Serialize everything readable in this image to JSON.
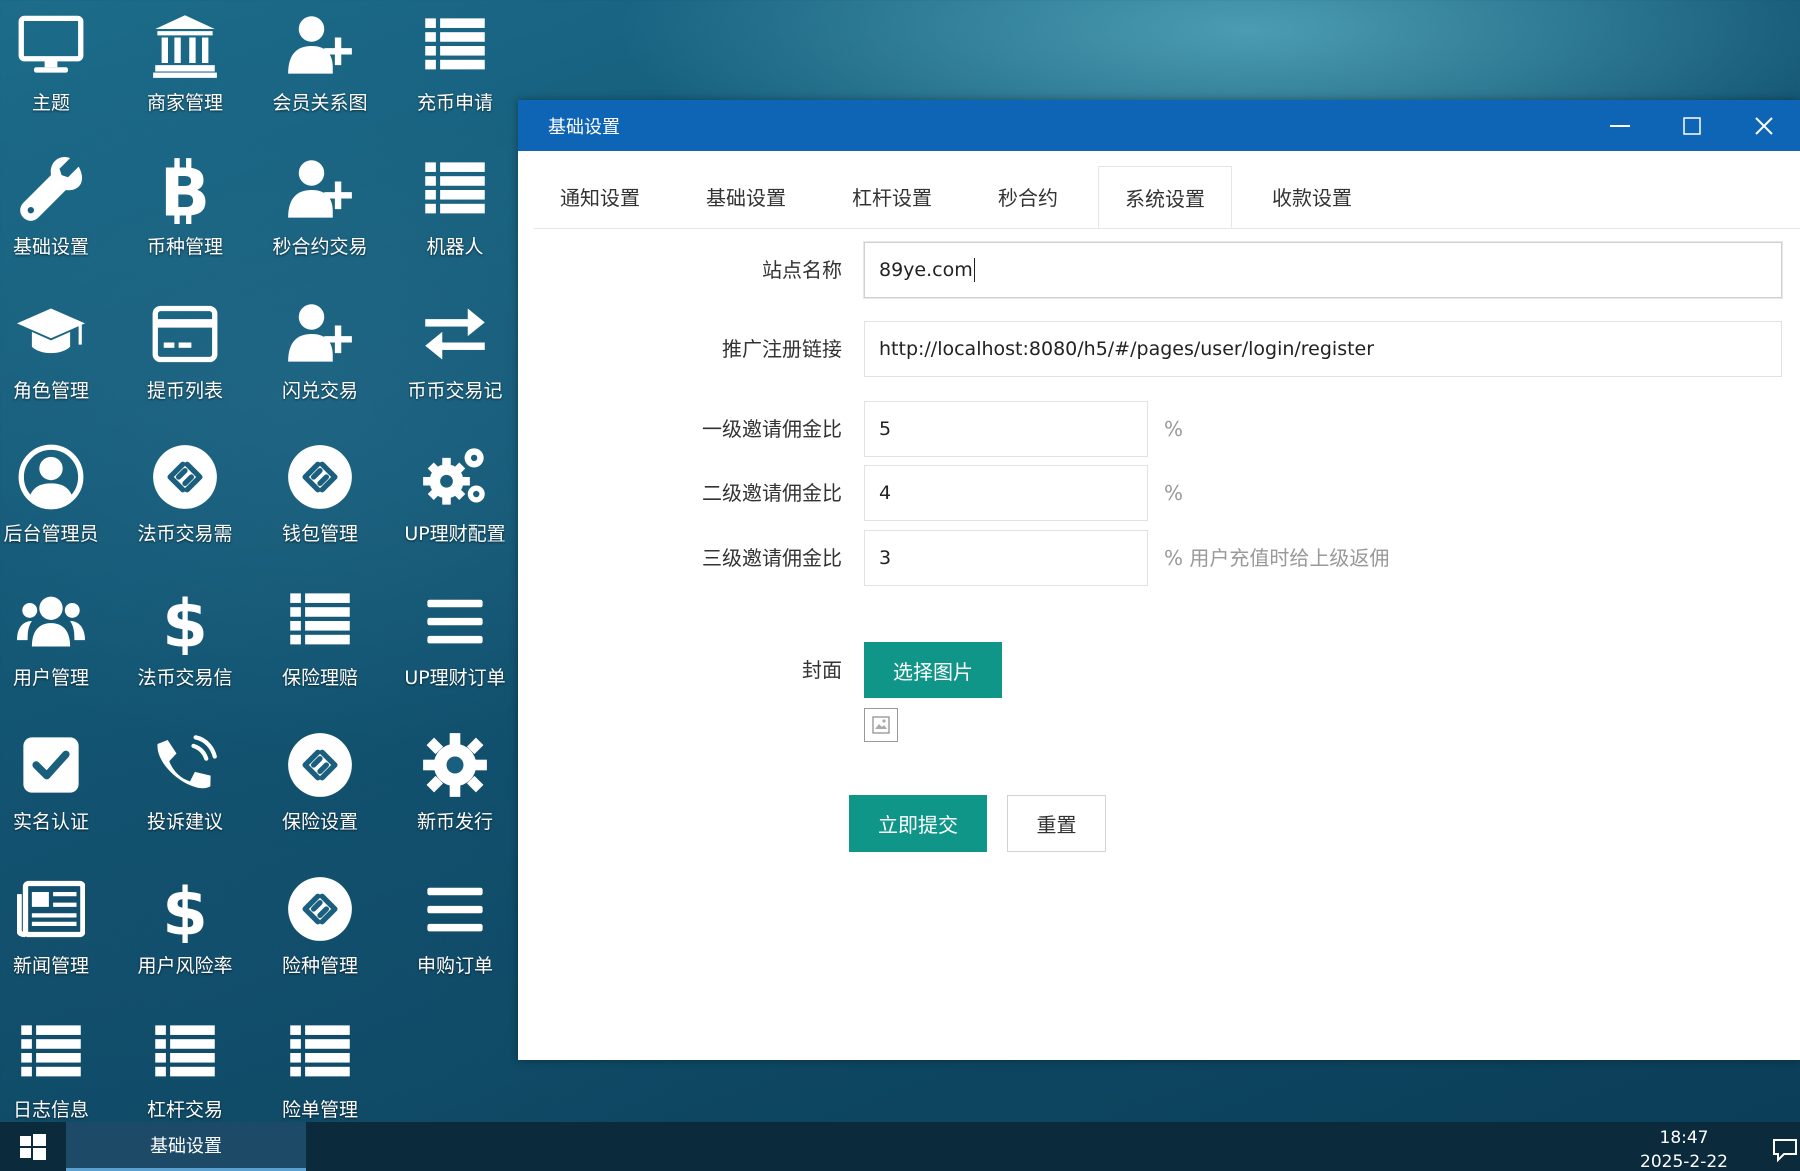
{
  "desktop_icons": [
    {
      "label": "主题",
      "icon": "monitor-icon"
    },
    {
      "label": "商家管理",
      "icon": "bank-icon"
    },
    {
      "label": "会员关系图",
      "icon": "user-plus-icon"
    },
    {
      "label": "充币申请",
      "icon": "list-icon"
    },
    {
      "label": "基础设置",
      "icon": "wrench-icon"
    },
    {
      "label": "币种管理",
      "icon": "bitcoin-icon"
    },
    {
      "label": "秒合约交易",
      "icon": "user-plus-icon"
    },
    {
      "label": "机器人",
      "icon": "list-icon"
    },
    {
      "label": "角色管理",
      "icon": "graduation-cap-icon"
    },
    {
      "label": "提币列表",
      "icon": "credit-card-icon"
    },
    {
      "label": "闪兑交易",
      "icon": "user-plus-icon"
    },
    {
      "label": "币币交易记",
      "icon": "exchange-icon"
    },
    {
      "label": "后台管理员",
      "icon": "user-circle-icon"
    },
    {
      "label": "法币交易需",
      "icon": "link-circle-icon"
    },
    {
      "label": "钱包管理",
      "icon": "link-circle-icon"
    },
    {
      "label": "UP理财配置",
      "icon": "gears-icon"
    },
    {
      "label": "用户管理",
      "icon": "users-icon"
    },
    {
      "label": "法币交易信",
      "icon": "dollar-icon"
    },
    {
      "label": "保险理赔",
      "icon": "list-icon"
    },
    {
      "label": "UP理财订单",
      "icon": "bars-icon"
    },
    {
      "label": "实名认证",
      "icon": "check-square-icon"
    },
    {
      "label": "投诉建议",
      "icon": "phone-volume-icon"
    },
    {
      "label": "保险设置",
      "icon": "link-circle-icon"
    },
    {
      "label": "新币发行",
      "icon": "gear-icon"
    },
    {
      "label": "新闻管理",
      "icon": "newspaper-icon"
    },
    {
      "label": "用户风险率",
      "icon": "dollar-icon"
    },
    {
      "label": "险种管理",
      "icon": "link-circle-icon"
    },
    {
      "label": "申购订单",
      "icon": "bars-icon"
    },
    {
      "label": "日志信息",
      "icon": "list-icon"
    },
    {
      "label": "杠杆交易",
      "icon": "list-icon"
    },
    {
      "label": "险单管理",
      "icon": "list-icon"
    }
  ],
  "window": {
    "title": "基础设置",
    "tabs": [
      "通知设置",
      "基础设置",
      "杠杆设置",
      "秒合约",
      "系统设置",
      "收款设置"
    ],
    "active_tab": "系统设置",
    "form": {
      "site_name_label": "站点名称",
      "site_name_value": "89ye.com",
      "promo_link_label": "推广注册链接",
      "promo_link_value": "http://localhost:8080/h5/#/pages/user/login/register",
      "level1_label": "一级邀请佣金比",
      "level1_value": "5",
      "level1_unit": "%",
      "level2_label": "二级邀请佣金比",
      "level2_value": "4",
      "level2_unit": "%",
      "level3_label": "三级邀请佣金比",
      "level3_value": "3",
      "level3_unit": "% 用户充值时给上级返佣",
      "cover_label": "封面",
      "choose_image_button": "选择图片",
      "submit_button": "立即提交",
      "reset_button": "重置"
    }
  },
  "taskbar": {
    "active_task": "基础设置",
    "time": "18:47",
    "date": "2025-2-22"
  },
  "colors": {
    "titlebar": "#0e64b5",
    "button_green": "#109688",
    "taskbar": "#0b2a3c"
  }
}
